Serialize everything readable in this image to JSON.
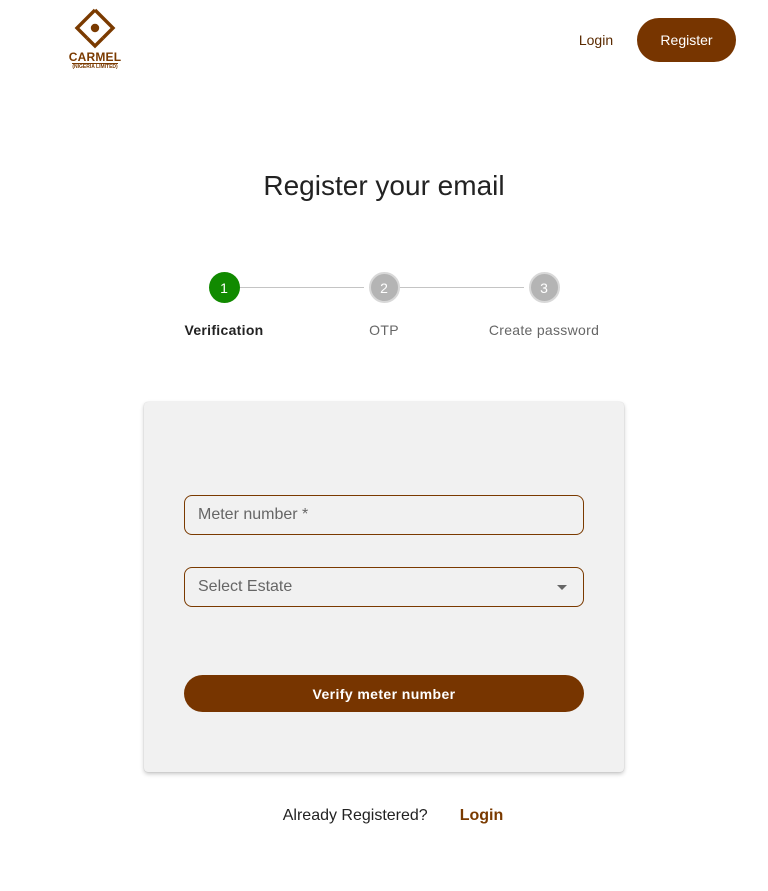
{
  "brand": {
    "name": "CARMEL",
    "subtitle": "(NIGERIA LIMITED)",
    "color": "#7a3a00"
  },
  "nav": {
    "login_label": "Login",
    "register_label": "Register"
  },
  "page": {
    "title": "Register your email"
  },
  "stepper": {
    "active_color": "#118a00",
    "steps": [
      {
        "number": "1",
        "label": "Verification",
        "state": "active"
      },
      {
        "number": "2",
        "label": "OTP",
        "state": "pending"
      },
      {
        "number": "3",
        "label": "Create password",
        "state": "pending"
      }
    ]
  },
  "form": {
    "meter_placeholder": "Meter number *",
    "meter_value": "",
    "estate_placeholder": "Select Estate",
    "estate_value": "",
    "verify_label": "Verify meter number"
  },
  "footer": {
    "prompt": "Already Registered?",
    "login_label": "Login"
  },
  "colors": {
    "primary": "#773500",
    "card_background": "#f1f1f1"
  }
}
